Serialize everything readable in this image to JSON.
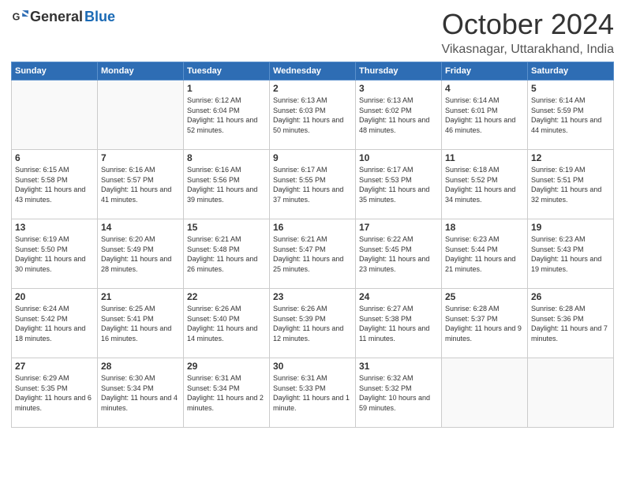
{
  "header": {
    "logo_general": "General",
    "logo_blue": "Blue",
    "month_title": "October 2024",
    "location": "Vikasnagar, Uttarakhand, India"
  },
  "days_of_week": [
    "Sunday",
    "Monday",
    "Tuesday",
    "Wednesday",
    "Thursday",
    "Friday",
    "Saturday"
  ],
  "weeks": [
    [
      {
        "day": "",
        "empty": true
      },
      {
        "day": "",
        "empty": true
      },
      {
        "day": "1",
        "sunrise": "6:12 AM",
        "sunset": "6:04 PM",
        "daylight": "11 hours and 52 minutes."
      },
      {
        "day": "2",
        "sunrise": "6:13 AM",
        "sunset": "6:03 PM",
        "daylight": "11 hours and 50 minutes."
      },
      {
        "day": "3",
        "sunrise": "6:13 AM",
        "sunset": "6:02 PM",
        "daylight": "11 hours and 48 minutes."
      },
      {
        "day": "4",
        "sunrise": "6:14 AM",
        "sunset": "6:01 PM",
        "daylight": "11 hours and 46 minutes."
      },
      {
        "day": "5",
        "sunrise": "6:14 AM",
        "sunset": "5:59 PM",
        "daylight": "11 hours and 44 minutes."
      }
    ],
    [
      {
        "day": "6",
        "sunrise": "6:15 AM",
        "sunset": "5:58 PM",
        "daylight": "11 hours and 43 minutes."
      },
      {
        "day": "7",
        "sunrise": "6:16 AM",
        "sunset": "5:57 PM",
        "daylight": "11 hours and 41 minutes."
      },
      {
        "day": "8",
        "sunrise": "6:16 AM",
        "sunset": "5:56 PM",
        "daylight": "11 hours and 39 minutes."
      },
      {
        "day": "9",
        "sunrise": "6:17 AM",
        "sunset": "5:55 PM",
        "daylight": "11 hours and 37 minutes."
      },
      {
        "day": "10",
        "sunrise": "6:17 AM",
        "sunset": "5:53 PM",
        "daylight": "11 hours and 35 minutes."
      },
      {
        "day": "11",
        "sunrise": "6:18 AM",
        "sunset": "5:52 PM",
        "daylight": "11 hours and 34 minutes."
      },
      {
        "day": "12",
        "sunrise": "6:19 AM",
        "sunset": "5:51 PM",
        "daylight": "11 hours and 32 minutes."
      }
    ],
    [
      {
        "day": "13",
        "sunrise": "6:19 AM",
        "sunset": "5:50 PM",
        "daylight": "11 hours and 30 minutes."
      },
      {
        "day": "14",
        "sunrise": "6:20 AM",
        "sunset": "5:49 PM",
        "daylight": "11 hours and 28 minutes."
      },
      {
        "day": "15",
        "sunrise": "6:21 AM",
        "sunset": "5:48 PM",
        "daylight": "11 hours and 26 minutes."
      },
      {
        "day": "16",
        "sunrise": "6:21 AM",
        "sunset": "5:47 PM",
        "daylight": "11 hours and 25 minutes."
      },
      {
        "day": "17",
        "sunrise": "6:22 AM",
        "sunset": "5:45 PM",
        "daylight": "11 hours and 23 minutes."
      },
      {
        "day": "18",
        "sunrise": "6:23 AM",
        "sunset": "5:44 PM",
        "daylight": "11 hours and 21 minutes."
      },
      {
        "day": "19",
        "sunrise": "6:23 AM",
        "sunset": "5:43 PM",
        "daylight": "11 hours and 19 minutes."
      }
    ],
    [
      {
        "day": "20",
        "sunrise": "6:24 AM",
        "sunset": "5:42 PM",
        "daylight": "11 hours and 18 minutes."
      },
      {
        "day": "21",
        "sunrise": "6:25 AM",
        "sunset": "5:41 PM",
        "daylight": "11 hours and 16 minutes."
      },
      {
        "day": "22",
        "sunrise": "6:26 AM",
        "sunset": "5:40 PM",
        "daylight": "11 hours and 14 minutes."
      },
      {
        "day": "23",
        "sunrise": "6:26 AM",
        "sunset": "5:39 PM",
        "daylight": "11 hours and 12 minutes."
      },
      {
        "day": "24",
        "sunrise": "6:27 AM",
        "sunset": "5:38 PM",
        "daylight": "11 hours and 11 minutes."
      },
      {
        "day": "25",
        "sunrise": "6:28 AM",
        "sunset": "5:37 PM",
        "daylight": "11 hours and 9 minutes."
      },
      {
        "day": "26",
        "sunrise": "6:28 AM",
        "sunset": "5:36 PM",
        "daylight": "11 hours and 7 minutes."
      }
    ],
    [
      {
        "day": "27",
        "sunrise": "6:29 AM",
        "sunset": "5:35 PM",
        "daylight": "11 hours and 6 minutes."
      },
      {
        "day": "28",
        "sunrise": "6:30 AM",
        "sunset": "5:34 PM",
        "daylight": "11 hours and 4 minutes."
      },
      {
        "day": "29",
        "sunrise": "6:31 AM",
        "sunset": "5:34 PM",
        "daylight": "11 hours and 2 minutes."
      },
      {
        "day": "30",
        "sunrise": "6:31 AM",
        "sunset": "5:33 PM",
        "daylight": "11 hours and 1 minute."
      },
      {
        "day": "31",
        "sunrise": "6:32 AM",
        "sunset": "5:32 PM",
        "daylight": "10 hours and 59 minutes."
      },
      {
        "day": "",
        "empty": true
      },
      {
        "day": "",
        "empty": true
      }
    ]
  ]
}
